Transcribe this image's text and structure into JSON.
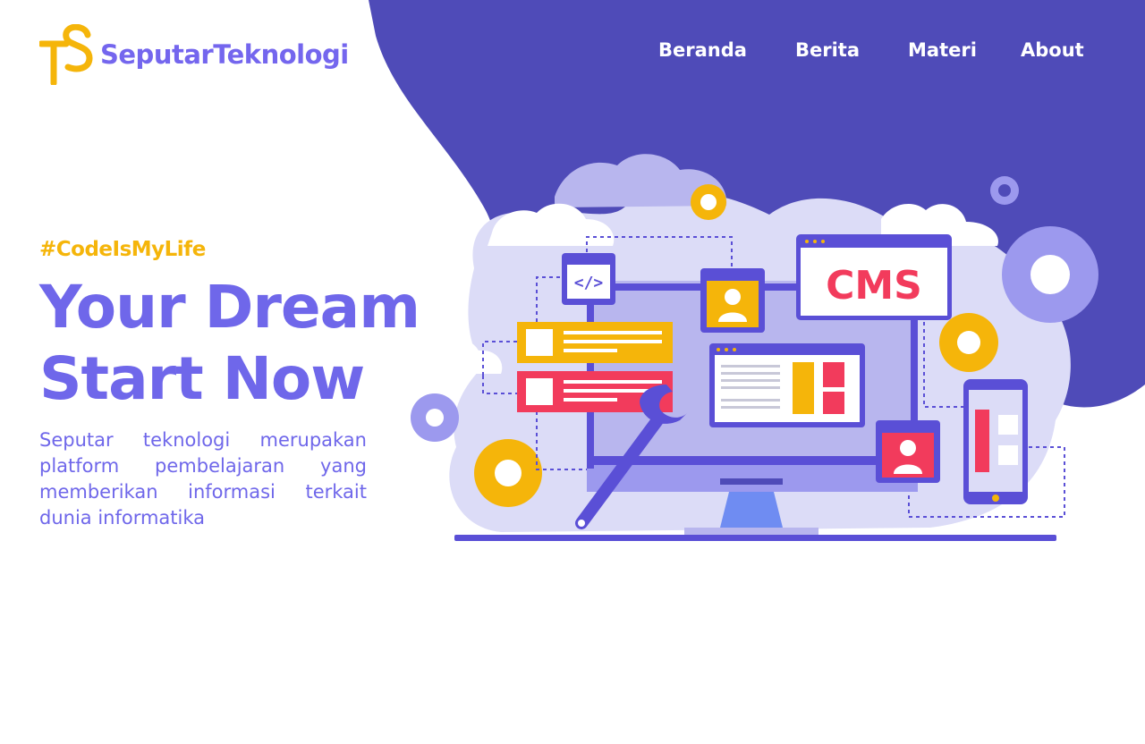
{
  "header": {
    "brand_name": "SeputarTeknologi",
    "logo_letters": "ST",
    "nav": [
      {
        "label": "Beranda"
      },
      {
        "label": "Berita"
      },
      {
        "label": "Materi"
      },
      {
        "label": "About"
      }
    ]
  },
  "hero": {
    "tag": "#CodeIsMyLife",
    "headline_line1": "Your Dream",
    "headline_line2": "Start Now",
    "description": "Seputar teknologi merupakan platform pembelajaran yang memberikan informasi terkait dunia informatika"
  },
  "illustration": {
    "screen_label": "CMS",
    "code_tag": "</>",
    "subject": "cms-web-development"
  },
  "colors": {
    "primary": "#4f4bb8",
    "accent_purple": "#6f67ea",
    "accent_yellow": "#f5b50a",
    "accent_red": "#f23b5c",
    "background": "#ffffff"
  }
}
